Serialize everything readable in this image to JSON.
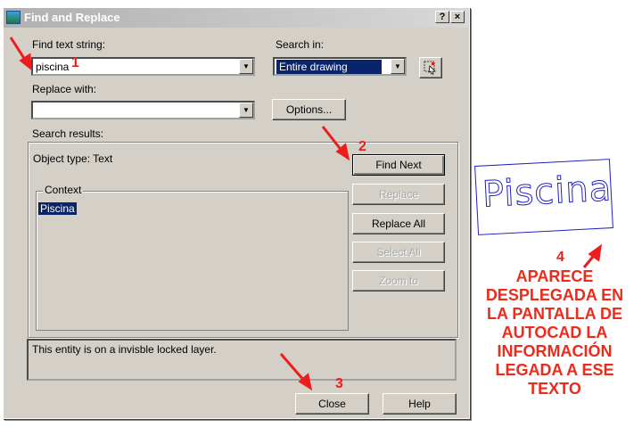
{
  "window": {
    "title": "Find and Replace",
    "help_btn": "?",
    "close_btn": "×"
  },
  "find": {
    "label": "Find text string:",
    "value": "piscina"
  },
  "search_in": {
    "label": "Search in:",
    "value": "Entire drawing"
  },
  "replace": {
    "label": "Replace with:",
    "value": ""
  },
  "options_button": "Options...",
  "search_results_label": "Search results:",
  "object_type": "Object type: Text",
  "context": {
    "legend": "Context",
    "selected_item": "Piscina"
  },
  "buttons": {
    "find_next": "Find Next",
    "replace": "Replace",
    "replace_all": "Replace All",
    "select_all": "Select All",
    "zoom_to": "Zoom to"
  },
  "status_message": "This entity is on a invisble locked layer.",
  "bottom_buttons": {
    "close": "Close",
    "help": "Help"
  },
  "annotations": {
    "n1": "1",
    "n2": "2",
    "n3": "3",
    "n4": "4",
    "overlay": [
      "APARECE",
      "DESPLEGADA EN",
      "LA PANTALLA DE",
      "AUTOCAD LA",
      "INFORMACIÓN",
      "LEGADA A ESE",
      "TEXTO"
    ],
    "drawing_text": "Piscina",
    "color": "#ee2a1a"
  }
}
